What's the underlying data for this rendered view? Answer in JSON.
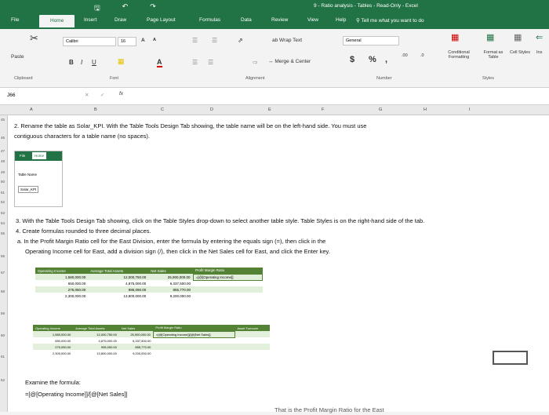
{
  "window": {
    "title": "9 - Ratio analysis - Tables - Read-Only - Excel"
  },
  "tabs": [
    "File",
    "Home",
    "Insert",
    "Draw",
    "Page Layout",
    "Formulas",
    "Data",
    "Review",
    "View",
    "Help"
  ],
  "tell_me": "Tell me what you want to do",
  "ribbon": {
    "font_name": "Calibri",
    "font_size": "16",
    "paste": "Paste",
    "wrap_text": "Wrap Text",
    "merge_center": "Merge & Center",
    "number_format": "General",
    "conditional": "Conditional Formatting",
    "format_as_table": "Format as Table",
    "cell_styles": "Cell Styles",
    "insert": "Ins",
    "groups": {
      "clipboard": "Clipboard",
      "font": "Font",
      "alignment": "Alignment",
      "number": "Number",
      "styles": "Styles"
    }
  },
  "formula_bar": {
    "name_box": "J66",
    "fx": "fx",
    "value": ""
  },
  "columns": [
    "A",
    "B",
    "C",
    "D",
    "E",
    "F",
    "G",
    "H",
    "I"
  ],
  "rows": [
    "45",
    "46",
    "47",
    "48",
    "49",
    "50",
    "51",
    "52",
    "53",
    "54",
    "55",
    "56",
    "57",
    "58",
    "59",
    "60",
    "61",
    "62"
  ],
  "content": {
    "step2_line1": "2.  Rename the table as Solar_KPI.  With the Table Tools Design Tab showing, the table name will be on the left-hand side.  You must use",
    "step2_line2": "contiguous characters for a table name (no spaces).",
    "mini_file": "File",
    "mini_home": "Home",
    "mini_table_name": "Table Name",
    "mini_name_value": "Solar_KPI",
    "step3": "3.    With the Table Tools Design Tab showing, click on the Table Styles drop-down to select another table style. Table Styles is on the right-hand side of the tab.",
    "step4": "4.    Create formulas rounded to three decimal places.",
    "step4a_line1": "a.    In the Profit Margin Ratio cell for the East Division, enter the formula by entering the equals sign (=), then click in the",
    "step4a_line2": "Operating Income cell for East, add a division sign (/), then click in the Net Sales cell for East, and click the Enter key.",
    "examine_label": "Examine the formula:",
    "examine_formula": "=[@[Operating Income]]/[@[Net Sales]]",
    "bottom_partial": "That is the Profit Margin Ratio for the East"
  },
  "table1": {
    "headers": [
      "Operating Income",
      "Average Total Assets",
      "Net Sales",
      "Profit Margin Ratio"
    ],
    "rows": [
      [
        "1,580,000.00",
        "12,000,750.00",
        "25,900,000.00",
        "=[@[Operating Income]]"
      ],
      [
        "650,000.00",
        "4,875,000.00",
        "6,337,500.00",
        ""
      ],
      [
        "275,050.00",
        "995,090.00",
        "855,770.00",
        ""
      ],
      [
        "2,300,000.00",
        "13,800,000.00",
        "9,200,000.00",
        ""
      ]
    ]
  },
  "table2": {
    "headers": [
      "Operating Income",
      "Average Total Assets",
      "Net Sales",
      "Profit Margin Ratio",
      "Asset Turnover"
    ],
    "rows": [
      [
        "1,580,000.00",
        "12,000,750.00",
        "25,900,000.00",
        "=[@[Operating Income]]/[@[Net Sales]]",
        ""
      ],
      [
        "650,000.00",
        "4,875,000.00",
        "6,337,500.00",
        "",
        ""
      ],
      [
        "275,050.00",
        "995,090.00",
        "855,770.00",
        "",
        ""
      ],
      [
        "2,300,000.00",
        "13,800,000.00",
        "9,200,000.00",
        "",
        ""
      ]
    ]
  }
}
